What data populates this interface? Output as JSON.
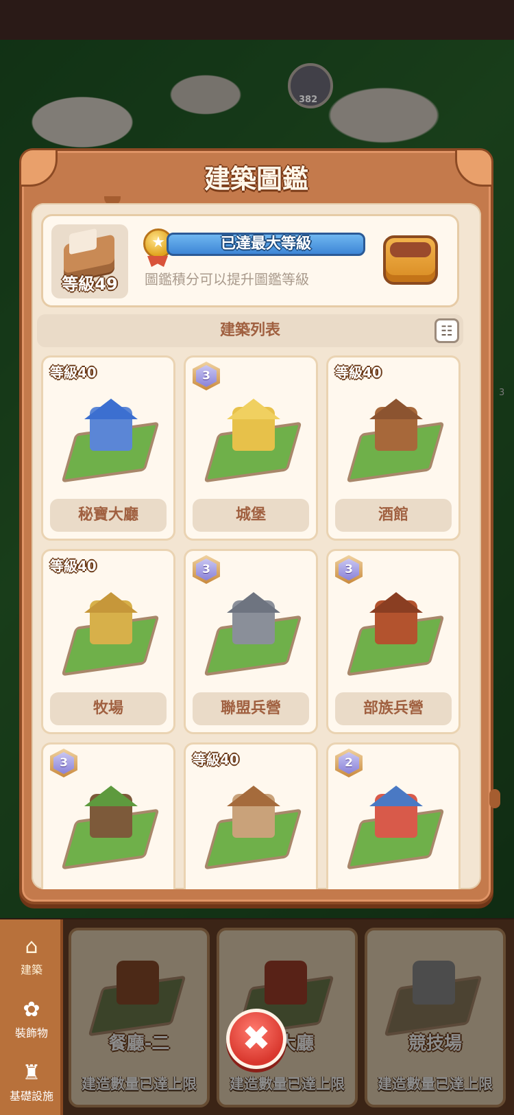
{
  "scene": {
    "badge_value": "382",
    "side_value": "3"
  },
  "modal": {
    "title": "建築圖鑑",
    "level_card": {
      "level_badge": "等級49",
      "progress_label": "已達最大等級",
      "hint": "圖鑑積分可以提升圖鑑等級"
    },
    "section_title": "建築列表",
    "buildings": [
      {
        "name": "秘寶大廳",
        "badge_type": "level",
        "badge": "等級40",
        "color": "#5b86d6",
        "roof": "#3c6fd0"
      },
      {
        "name": "城堡",
        "badge_type": "hex",
        "badge": "3",
        "color": "#e7c14a",
        "roof": "#f0d060"
      },
      {
        "name": "酒館",
        "badge_type": "level",
        "badge": "等級40",
        "color": "#a7683a",
        "roof": "#8c5430"
      },
      {
        "name": "牧場",
        "badge_type": "level",
        "badge": "等級40",
        "color": "#d7b04a",
        "roof": "#c6973a"
      },
      {
        "name": "聯盟兵營",
        "badge_type": "hex",
        "badge": "3",
        "color": "#8a8f99",
        "roof": "#6e7480"
      },
      {
        "name": "部族兵營",
        "badge_type": "hex",
        "badge": "3",
        "color": "#b3532e",
        "roof": "#8a3e22"
      },
      {
        "name": "",
        "badge_type": "hex",
        "badge": "3",
        "color": "#7d5a3a",
        "roof": "#5e9a3e"
      },
      {
        "name": "",
        "badge_type": "level",
        "badge": "等級40",
        "color": "#c9a27a",
        "roof": "#a56b3c"
      },
      {
        "name": "",
        "badge_type": "hex",
        "badge": "2",
        "color": "#d85a4a",
        "roof": "#4a79c4"
      }
    ]
  },
  "side_nav": [
    {
      "label": "建築",
      "icon": "house-icon",
      "glyph": "⌂"
    },
    {
      "label": "裝飾物",
      "icon": "flower-icon",
      "glyph": "✿"
    },
    {
      "label": "基礎設施",
      "icon": "castle-icon",
      "glyph": "♜"
    }
  ],
  "build_cards": [
    {
      "name": "餐廳-二",
      "status": "建造數量已達上限"
    },
    {
      "name": "王大廳",
      "status": "建造數量已達上限"
    },
    {
      "name": "競技場",
      "status": "建造數量已達上限"
    }
  ],
  "close_glyph": "✖",
  "colors": {
    "modal_frame": "#c47a4c",
    "modal_inner": "#f3e5d2",
    "progress_blue": "#3e86d6",
    "close_red": "#d9382e",
    "label_brown": "#a06040"
  }
}
